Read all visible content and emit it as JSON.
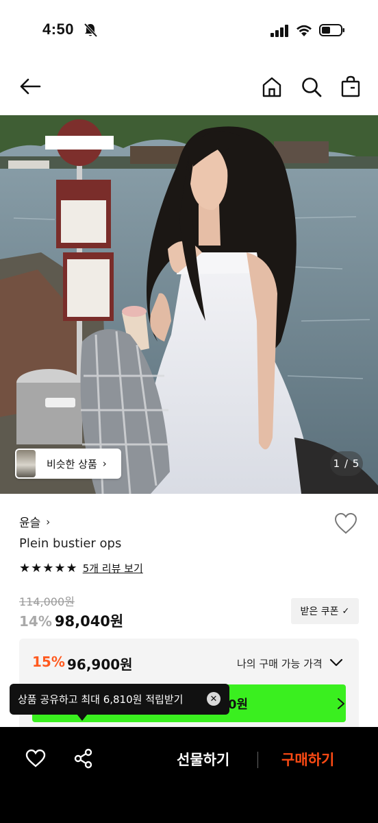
{
  "status_bar": {
    "time": "4:50"
  },
  "gallery": {
    "similar_label": "비슷한 상품",
    "similar_chevron": "›",
    "counter": "1 / 5"
  },
  "product": {
    "brand": "윤슬",
    "brand_chevron": "›",
    "name": "Plein bustier ops",
    "stars": "★★★★★",
    "rating_stars": 5,
    "review_link": "5개 리뷰 보기",
    "original_price": "114,000원",
    "discount": "14%",
    "price": "98,040원",
    "coupon_label": "받은 쿠폰",
    "coupon_check": "✓"
  },
  "best_price": {
    "discount": "15%",
    "price": "96,900원",
    "my_buy_label": "나의 구매 가능 가격",
    "button_text_visible": "0원"
  },
  "tooltip": {
    "text": "상품 공유하고 최대 6,810원 적립받기",
    "close": "✕"
  },
  "bottom_bar": {
    "gift_label": "선물하기",
    "buy_label": "구매하기"
  },
  "colors": {
    "accent_orange": "#ff5a1f",
    "buy_red": "#ff4b14",
    "green_button": "#3aef1f",
    "bottom_bar_bg": "#000000"
  },
  "icons": [
    "bell-off-icon",
    "cellular-signal-icon",
    "wifi-icon",
    "battery-icon",
    "back-arrow-icon",
    "home-icon",
    "search-icon",
    "shopping-bag-icon",
    "heart-icon",
    "share-icon",
    "chevron-down-icon",
    "chevron-right-icon",
    "close-icon",
    "checkmark-icon"
  ]
}
